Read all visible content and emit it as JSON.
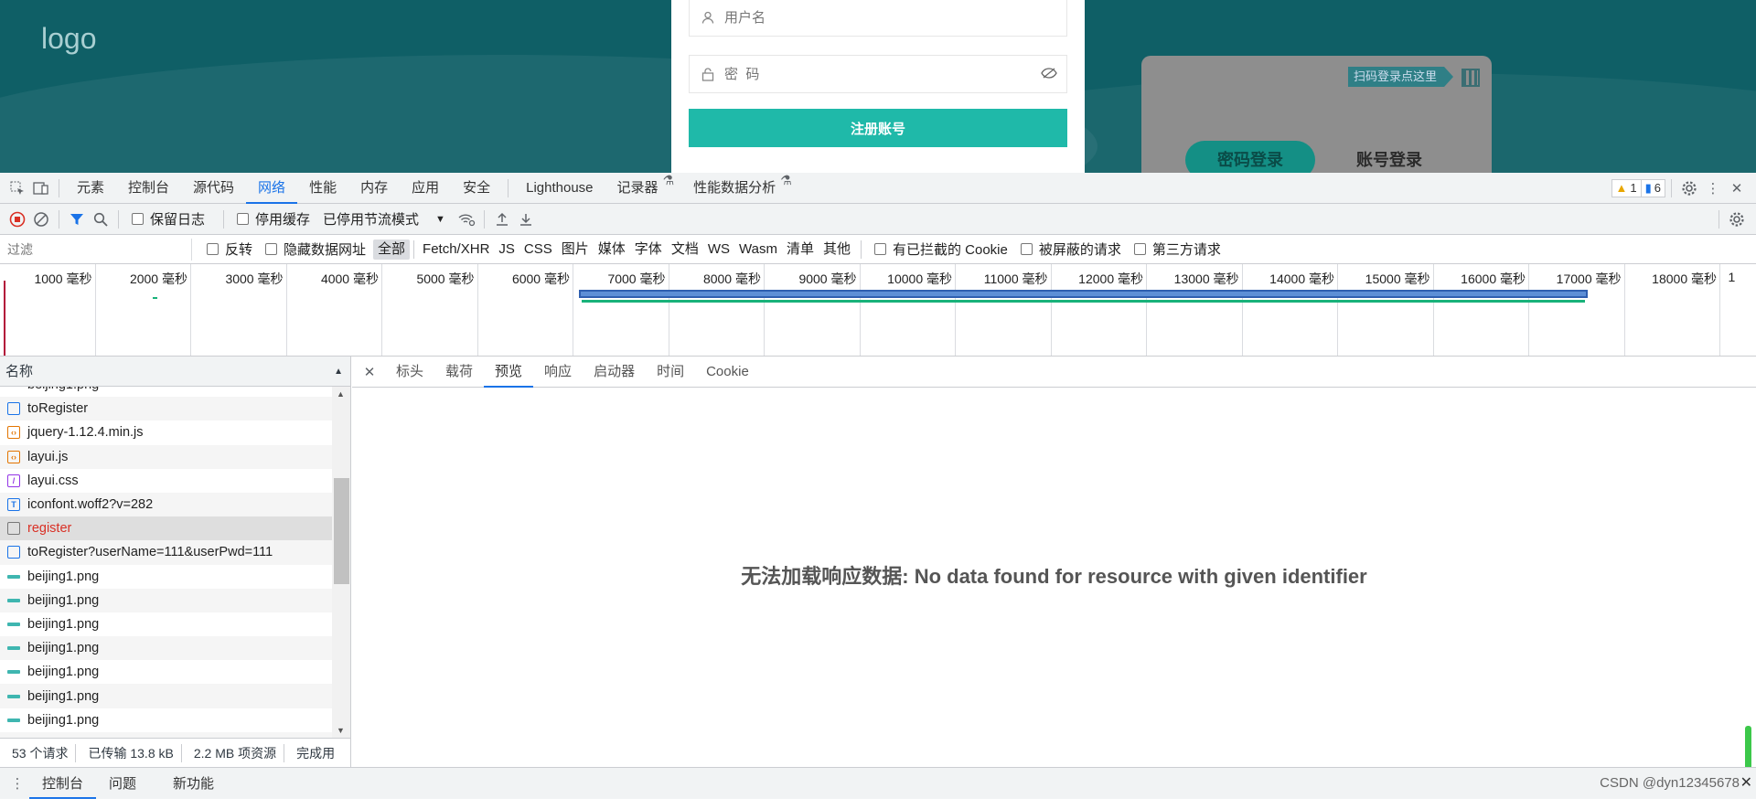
{
  "page": {
    "logo": "logo",
    "form": {
      "username_placeholder": "用户名",
      "password_placeholder": "密  码",
      "submit_label": "注册账号"
    },
    "login_card": {
      "qr_tip": "扫码登录点这里",
      "tab_password": "密码登录",
      "tab_account": "账号登录"
    }
  },
  "devtools": {
    "main_tabs": [
      "元素",
      "控制台",
      "源代码",
      "网络",
      "性能",
      "内存",
      "应用",
      "安全",
      "Lighthouse",
      "记录器",
      "性能数据分析"
    ],
    "active_main_tab": "网络",
    "warnings_count": "1",
    "messages_count": "6",
    "toolbar": {
      "preserve_log": "保留日志",
      "disable_cache": "停用缓存",
      "throttle": "已停用节流模式"
    },
    "filter": {
      "placeholder": "过滤",
      "invert": "反转",
      "hide_data_urls": "隐藏数据网址",
      "types": [
        "全部",
        "Fetch/XHR",
        "JS",
        "CSS",
        "图片",
        "媒体",
        "字体",
        "文档",
        "WS",
        "Wasm",
        "清单",
        "其他"
      ],
      "blocked_cookies": "有已拦截的 Cookie",
      "blocked_requests": "被屏蔽的请求",
      "third_party": "第三方请求"
    },
    "timeline_labels": [
      "1000 毫秒",
      "2000 毫秒",
      "3000 毫秒",
      "4000 毫秒",
      "5000 毫秒",
      "6000 毫秒",
      "7000 毫秒",
      "8000 毫秒",
      "9000 毫秒",
      "10000 毫秒",
      "11000 毫秒",
      "12000 毫秒",
      "13000 毫秒",
      "14000 毫秒",
      "15000 毫秒",
      "16000 毫秒",
      "17000 毫秒",
      "18000 毫秒",
      "1"
    ],
    "request_list": {
      "header": "名称",
      "rows": [
        {
          "name": "beijing1.png",
          "type": "img"
        },
        {
          "name": "toRegister",
          "type": "doc"
        },
        {
          "name": "jquery-1.12.4.min.js",
          "type": "script"
        },
        {
          "name": "layui.js",
          "type": "script"
        },
        {
          "name": "layui.css",
          "type": "style"
        },
        {
          "name": "iconfont.woff2?v=282",
          "type": "font"
        },
        {
          "name": "register",
          "type": "other"
        },
        {
          "name": "toRegister?userName=111&userPwd=111",
          "type": "doc"
        },
        {
          "name": "beijing1.png",
          "type": "img"
        },
        {
          "name": "beijing1.png",
          "type": "img"
        },
        {
          "name": "beijing1.png",
          "type": "img"
        },
        {
          "name": "beijing1.png",
          "type": "img"
        },
        {
          "name": "beijing1.png",
          "type": "img"
        },
        {
          "name": "beijing1.png",
          "type": "img"
        },
        {
          "name": "beijing1.png",
          "type": "img"
        },
        {
          "name": "beijing1.png",
          "type": "img"
        }
      ]
    },
    "status": {
      "requests": "53 个请求",
      "transferred": "已传输 13.8 kB",
      "resources": "2.2 MB 项资源",
      "finish": "完成用"
    },
    "detail_tabs": [
      "标头",
      "载荷",
      "预览",
      "响应",
      "启动器",
      "时间",
      "Cookie"
    ],
    "active_detail_tab": "预览",
    "no_data_message": "无法加载响应数据: No data found for resource with given identifier",
    "drawer_tabs": [
      "控制台",
      "问题",
      "新功能"
    ],
    "watermark": "CSDN @dyn12345678"
  }
}
